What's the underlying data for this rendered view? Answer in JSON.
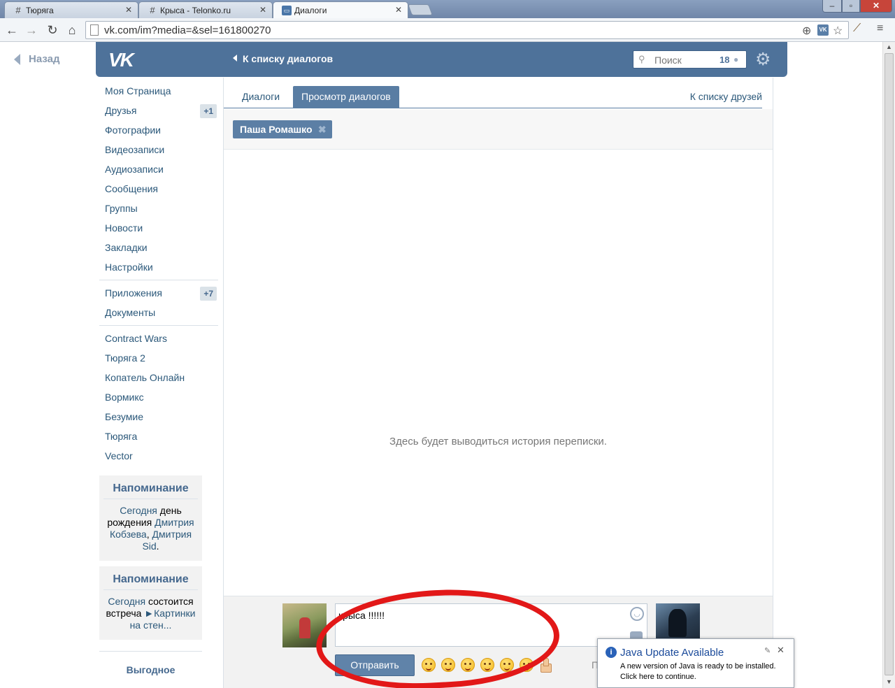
{
  "browser": {
    "tabs": [
      {
        "title": "Тюряга",
        "active": false
      },
      {
        "title": "Крыса - Telonko.ru",
        "active": false
      },
      {
        "title": "Диалоги",
        "active": true
      }
    ],
    "url": "vk.com/im?media=&sel=161800270"
  },
  "vk": {
    "back_label": "Назад",
    "header": {
      "logo": "VK",
      "to_dialogs": "К списку диалогов",
      "search_placeholder": "Поиск",
      "search_count": "18"
    },
    "sidebar": {
      "main": [
        {
          "label": "Моя Страница",
          "badge": ""
        },
        {
          "label": "Друзья",
          "badge": "+1"
        },
        {
          "label": "Фотографии",
          "badge": ""
        },
        {
          "label": "Видеозаписи",
          "badge": ""
        },
        {
          "label": "Аудиозаписи",
          "badge": ""
        },
        {
          "label": "Сообщения",
          "badge": ""
        },
        {
          "label": "Группы",
          "badge": ""
        },
        {
          "label": "Новости",
          "badge": ""
        },
        {
          "label": "Закладки",
          "badge": ""
        },
        {
          "label": "Настройки",
          "badge": ""
        }
      ],
      "apps": [
        {
          "label": "Приложения",
          "badge": "+7"
        },
        {
          "label": "Документы",
          "badge": ""
        }
      ],
      "games": [
        "Contract Wars",
        "Тюряга 2",
        "Копатель Онлайн",
        "Вормикс",
        "Безумие",
        "Тюряга",
        "Vector"
      ],
      "reminder1": {
        "title": "Напоминание",
        "t1": "Сегодня",
        "t2": " день рождения ",
        "name1": "Дмитрия Кобзева",
        "sep": ", ",
        "name2": "Дмитрия Sid",
        "end": "."
      },
      "reminder2": {
        "title": "Напоминание",
        "t1": "Сегодня",
        "t2": " состоится встреча ",
        "event": "►Картинки на стен..."
      },
      "more": "Выгодное"
    },
    "main": {
      "tab_dialogs": "Диалоги",
      "tab_view": "Просмотр диалогов",
      "friends_link": "К списку друзей",
      "peer": "Паша Ромашко",
      "empty_text": "Здесь будет выводиться история переписки.",
      "message_value": "крыса !!!!!!",
      "send_label": "Отправить",
      "partial_char": "П"
    }
  },
  "java_popup": {
    "title": "Java Update Available",
    "body": "A new version of Java is ready to be installed. Click here to continue."
  },
  "colors": {
    "vk_blue": "#4e729a",
    "link": "#2b587a",
    "annotation_red": "#e21818"
  },
  "icons": [
    "back-icon",
    "forward-icon",
    "reload-icon",
    "home-icon",
    "zoom-icon",
    "star-icon",
    "wrench-icon",
    "menu-icon",
    "search-icon",
    "gear-icon",
    "smile-icon",
    "camera-icon",
    "info-icon",
    "close-icon"
  ]
}
